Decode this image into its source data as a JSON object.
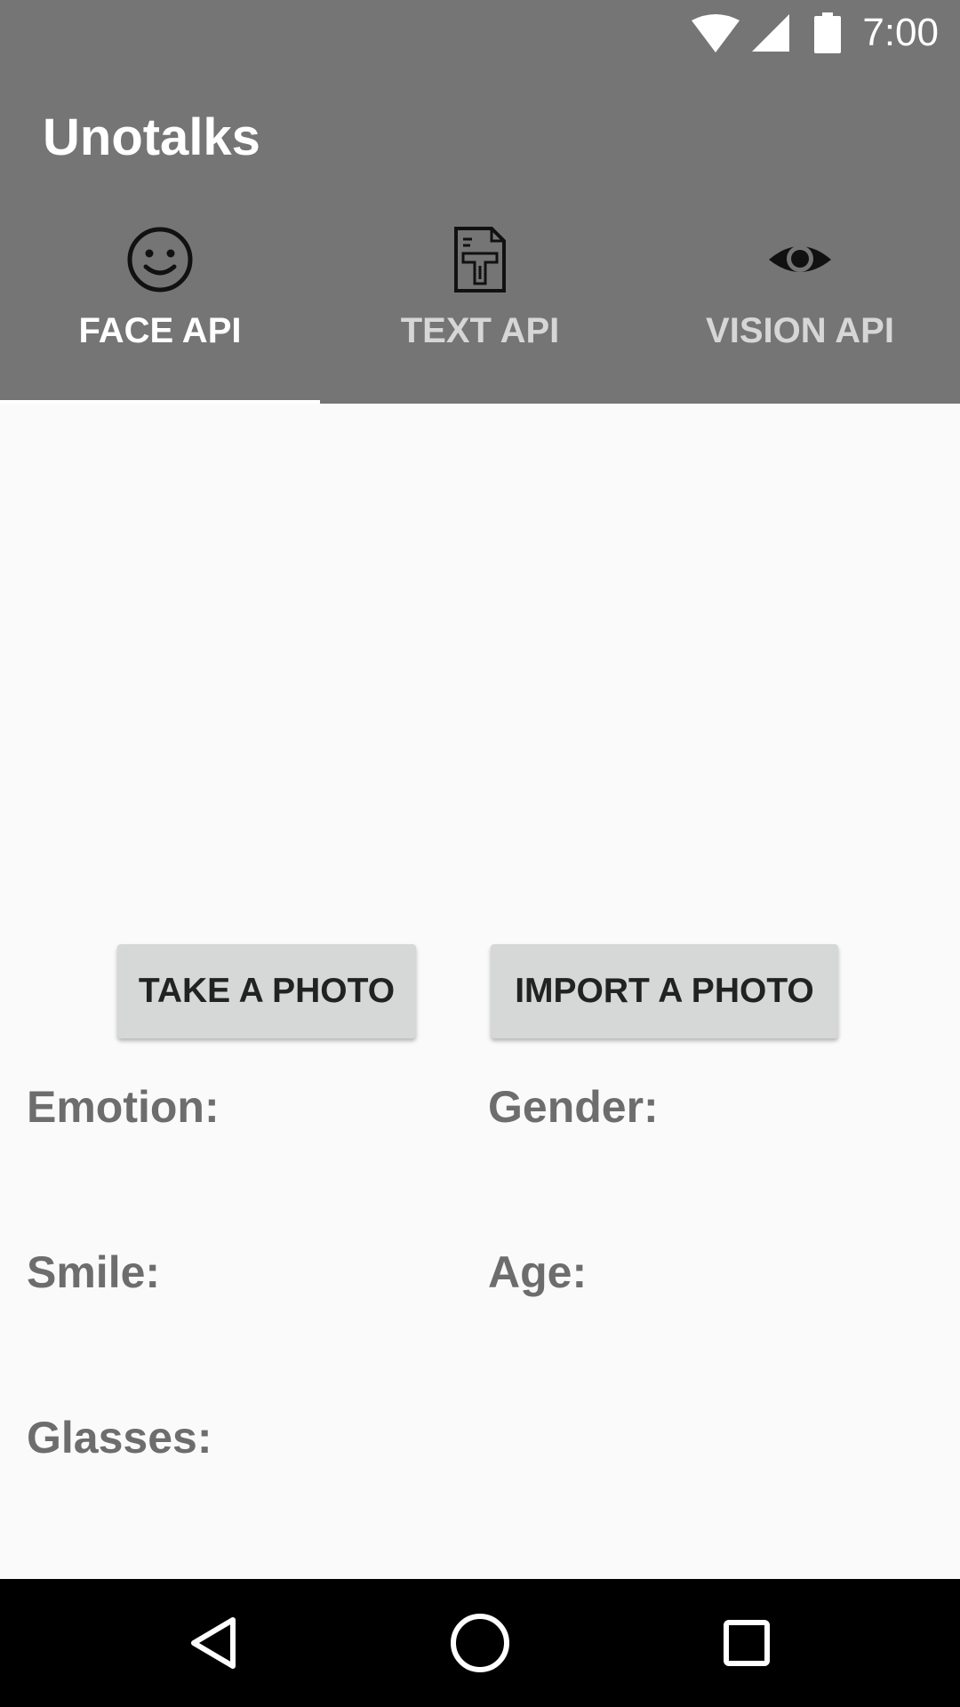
{
  "status_bar": {
    "time": "7:00",
    "icons": [
      "wifi-icon",
      "cell-signal-icon",
      "battery-icon"
    ],
    "color": "#757575"
  },
  "app_bar": {
    "title": "Unotalks",
    "color": "#757575"
  },
  "tabs": [
    {
      "label": "FACE API",
      "icon": "smiley-face-icon",
      "selected": true
    },
    {
      "label": "TEXT API",
      "icon": "text-document-icon",
      "selected": false
    },
    {
      "label": "VISION API",
      "icon": "eye-icon",
      "selected": false
    }
  ],
  "buttons": {
    "take_photo": "TAKE A PHOTO",
    "import_photo": "IMPORT A PHOTO"
  },
  "fields": {
    "emotion": "Emotion:",
    "gender": "Gender:",
    "smile": "Smile:",
    "age": "Age:",
    "glasses": "Glasses:"
  },
  "nav_bar": {
    "icons": [
      "back-icon",
      "home-icon",
      "recents-icon"
    ]
  }
}
